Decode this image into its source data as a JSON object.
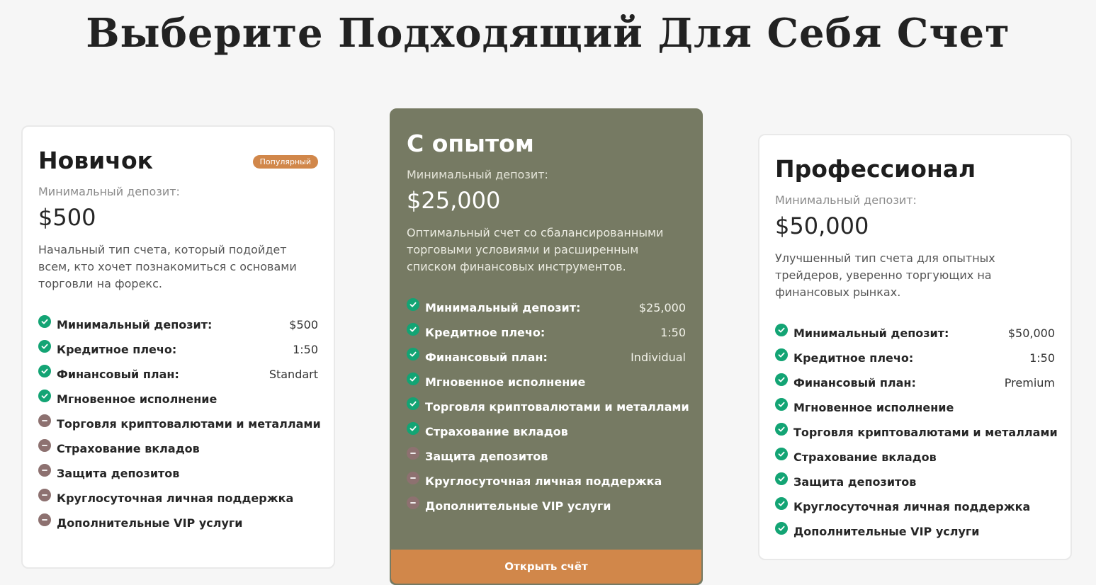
{
  "page": {
    "title": "Выберите Подходящий Для Себя Счет"
  },
  "colors": {
    "accent": "#d1874a",
    "featured_bg": "#767a63",
    "check": "#13a474",
    "minus": "#8d7170"
  },
  "plans": [
    {
      "name": "Новичок",
      "badge": "Популярный",
      "deposit_label": "Минимальный депозит:",
      "deposit_value": "$500",
      "description": "Начальный тип счета, который подойдет всем, кто хочет познакомиться с основами торговли на форекс.",
      "features": [
        {
          "label": "Минимальный депозит:",
          "value": "$500",
          "included": true
        },
        {
          "label": "Кредитное плечо:",
          "value": "1:50",
          "included": true
        },
        {
          "label": "Финансовый план:",
          "value": "Standart",
          "included": true
        },
        {
          "label": "Мгновенное исполнение",
          "value": "",
          "included": true
        },
        {
          "label": "Торговля криптовалютами и металлами",
          "value": "",
          "included": false
        },
        {
          "label": "Страхование вкладов",
          "value": "",
          "included": false
        },
        {
          "label": "Защита депозитов",
          "value": "",
          "included": false
        },
        {
          "label": "Круглосуточная личная поддержка",
          "value": "",
          "included": false
        },
        {
          "label": "Дополнительные VIP услуги",
          "value": "",
          "included": false
        }
      ]
    },
    {
      "name": "С опытом",
      "deposit_label": "Минимальный депозит:",
      "deposit_value": "$25,000",
      "description": "Оптимальный счет со сбалансированными торговыми условиями и расширенным списком финансовых инструментов.",
      "features": [
        {
          "label": "Минимальный депозит:",
          "value": "$25,000",
          "included": true
        },
        {
          "label": "Кредитное плечо:",
          "value": "1:50",
          "included": true
        },
        {
          "label": "Финансовый план:",
          "value": "Individual",
          "included": true
        },
        {
          "label": "Мгновенное исполнение",
          "value": "",
          "included": true
        },
        {
          "label": "Торговля криптовалютами и металлами",
          "value": "",
          "included": true
        },
        {
          "label": "Страхование вкладов",
          "value": "",
          "included": true
        },
        {
          "label": "Защита депозитов",
          "value": "",
          "included": false
        },
        {
          "label": "Круглосуточная личная поддержка",
          "value": "",
          "included": false
        },
        {
          "label": "Дополнительные VIP услуги",
          "value": "",
          "included": false
        }
      ],
      "cta": "Открыть счёт"
    },
    {
      "name": "Профессионал",
      "deposit_label": "Минимальный депозит:",
      "deposit_value": "$50,000",
      "description": "Улучшенный тип счета для опытных трейдеров, уверенно торгующих на финансовых рынках.",
      "features": [
        {
          "label": "Минимальный депозит:",
          "value": "$50,000",
          "included": true
        },
        {
          "label": "Кредитное плечо:",
          "value": "1:50",
          "included": true
        },
        {
          "label": "Финансовый план:",
          "value": "Premium",
          "included": true
        },
        {
          "label": "Мгновенное исполнение",
          "value": "",
          "included": true
        },
        {
          "label": "Торговля криптовалютами и металлами",
          "value": "",
          "included": true
        },
        {
          "label": "Страхование вкладов",
          "value": "",
          "included": true
        },
        {
          "label": "Защита депозитов",
          "value": "",
          "included": true
        },
        {
          "label": "Круглосуточная личная поддержка",
          "value": "",
          "included": true
        },
        {
          "label": "Дополнительные VIP услуги",
          "value": "",
          "included": true
        }
      ]
    }
  ]
}
